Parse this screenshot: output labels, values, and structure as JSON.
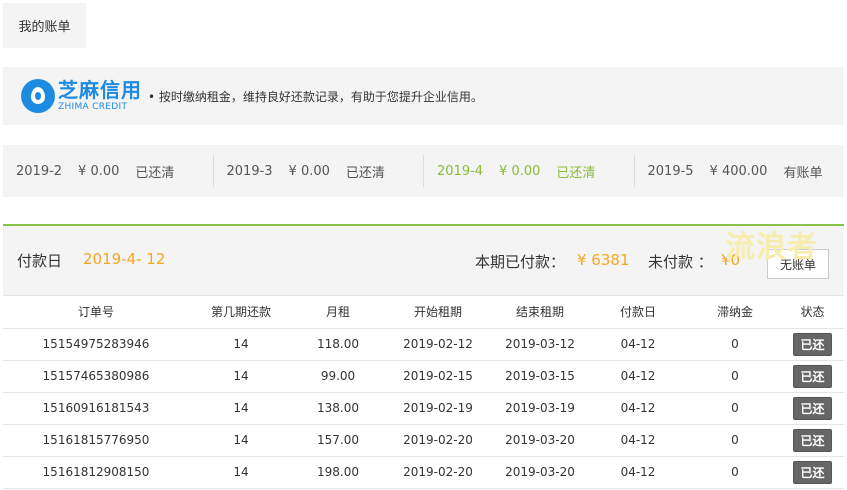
{
  "tab": {
    "label": "我的账单"
  },
  "zhima": {
    "logo_cn": "芝麻信用",
    "logo_en": "ZHIMA CREDIT",
    "message": "• 按时缴纳租金，维持良好还款记录，有助于您提升企业信用。"
  },
  "months": [
    {
      "month": "2019-2",
      "amount": "¥ 0.00",
      "status": "已还清",
      "active": false
    },
    {
      "month": "2019-3",
      "amount": "¥ 0.00",
      "status": "已还清",
      "active": false
    },
    {
      "month": "2019-4",
      "amount": "¥ 0.00",
      "status": "已还清",
      "active": true
    },
    {
      "month": "2019-5",
      "amount": "¥ 400.00",
      "status": "有账单",
      "active": false
    }
  ],
  "bill": {
    "pay_day_label": "付款日",
    "pay_day": "2019-4- 12",
    "paid_label": "本期已付款：",
    "paid_amount": "¥ 6381",
    "unpaid_label": "未付款 ：",
    "unpaid_amount": "¥0",
    "button_label": "无账单",
    "watermark": "流浪者"
  },
  "table": {
    "columns": [
      "订单号",
      "第几期还款",
      "月租",
      "开始租期",
      "结束租期",
      "付款日",
      "滞纳金",
      "状态"
    ],
    "rows": [
      [
        "15154975283946",
        "14",
        "118.00",
        "2019-02-12",
        "2019-03-12",
        "04-12",
        "0",
        "已还"
      ],
      [
        "15157465380986",
        "14",
        "99.00",
        "2019-02-15",
        "2019-03-15",
        "04-12",
        "0",
        "已还"
      ],
      [
        "15160916181543",
        "14",
        "138.00",
        "2019-02-19",
        "2019-03-19",
        "04-12",
        "0",
        "已还"
      ],
      [
        "15161815776950",
        "14",
        "157.00",
        "2019-02-20",
        "2019-03-20",
        "04-12",
        "0",
        "已还"
      ],
      [
        "15161812908150",
        "14",
        "198.00",
        "2019-02-20",
        "2019-03-20",
        "04-12",
        "0",
        "已还"
      ]
    ]
  }
}
